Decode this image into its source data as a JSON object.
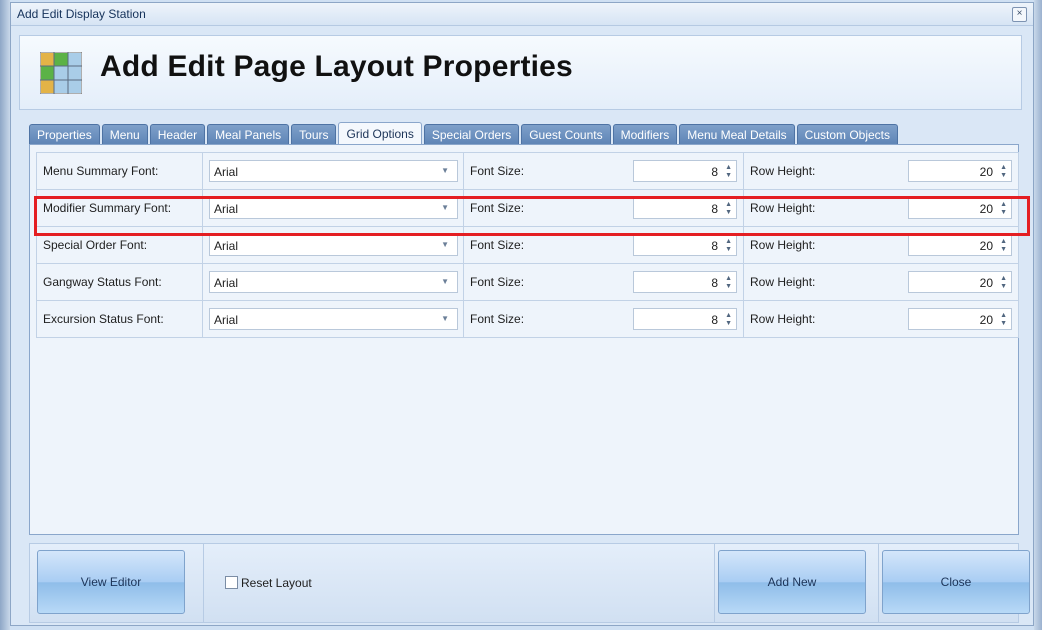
{
  "window": {
    "title": "Add Edit Display Station"
  },
  "header": {
    "title": "Add Edit Page Layout Properties"
  },
  "tabs": [
    {
      "label": "Properties",
      "active": false
    },
    {
      "label": "Menu",
      "active": false
    },
    {
      "label": "Header",
      "active": false
    },
    {
      "label": "Meal Panels",
      "active": false
    },
    {
      "label": "Tours",
      "active": false
    },
    {
      "label": "Grid Options",
      "active": true
    },
    {
      "label": "Special Orders",
      "active": false
    },
    {
      "label": "Guest Counts",
      "active": false
    },
    {
      "label": "Modifiers",
      "active": false
    },
    {
      "label": "Menu Meal Details",
      "active": false
    },
    {
      "label": "Custom Objects",
      "active": false
    }
  ],
  "grid": {
    "font_size_label": "Font Size:",
    "row_height_label": "Row Height:",
    "rows": [
      {
        "label": "Menu Summary Font:",
        "font": "Arial",
        "font_size": "8",
        "row_height": "20"
      },
      {
        "label": "Modifier Summary Font:",
        "font": "Arial",
        "font_size": "8",
        "row_height": "20"
      },
      {
        "label": "Special Order Font:",
        "font": "Arial",
        "font_size": "8",
        "row_height": "20"
      },
      {
        "label": "Gangway Status Font:",
        "font": "Arial",
        "font_size": "8",
        "row_height": "20"
      },
      {
        "label": "Excursion Status Font:",
        "font": "Arial",
        "font_size": "8",
        "row_height": "20"
      }
    ]
  },
  "footer": {
    "view_editor": "View Editor",
    "reset_layout": "Reset Layout",
    "add_new": "Add New",
    "close": "Close"
  },
  "icons": {
    "close": "close-icon",
    "app": "grid-layout-icon",
    "dropdown": "chevron-down-icon",
    "spin_up": "spin-up-icon",
    "spin_down": "spin-down-icon"
  },
  "colors": {
    "tab_inactive": "#6a8fbf",
    "highlight": "#e41e22",
    "button": "#a9cdf3"
  }
}
